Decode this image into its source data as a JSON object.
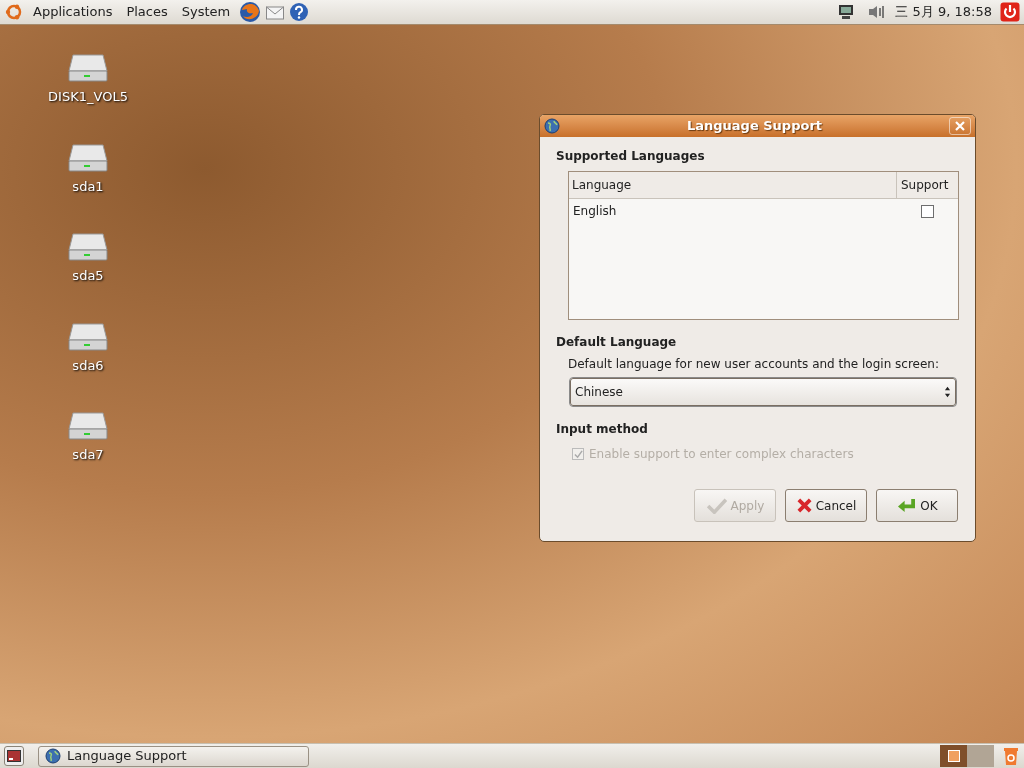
{
  "top_panel": {
    "menus": [
      "Applications",
      "Places",
      "System"
    ],
    "clock": "三 5月 9, 18:58"
  },
  "desktop_icons": [
    {
      "label": "DISK1_VOL5"
    },
    {
      "label": "sda1"
    },
    {
      "label": "sda5"
    },
    {
      "label": "sda6"
    },
    {
      "label": "sda7"
    }
  ],
  "window": {
    "title": "Language Support",
    "supported_languages": {
      "heading": "Supported Languages",
      "columns": [
        "Language",
        "Support"
      ],
      "rows": [
        {
          "language": "English",
          "checked": false
        }
      ]
    },
    "default_language": {
      "heading": "Default Language",
      "label": "Default language for new user accounts and the login screen:",
      "value": "Chinese"
    },
    "input_method": {
      "heading": "Input method",
      "option": {
        "label": "Enable support to enter complex characters",
        "checked": true,
        "disabled": true
      }
    },
    "buttons": [
      {
        "label": "Apply",
        "kind": "apply",
        "disabled": true
      },
      {
        "label": "Cancel",
        "kind": "cancel",
        "disabled": false
      },
      {
        "label": "OK",
        "kind": "ok",
        "disabled": false
      }
    ]
  },
  "taskbar": {
    "tasks": [
      {
        "label": "Language Support",
        "selected": false
      }
    ],
    "workspaces": [
      {
        "selected": true
      },
      {
        "selected": false
      }
    ]
  }
}
